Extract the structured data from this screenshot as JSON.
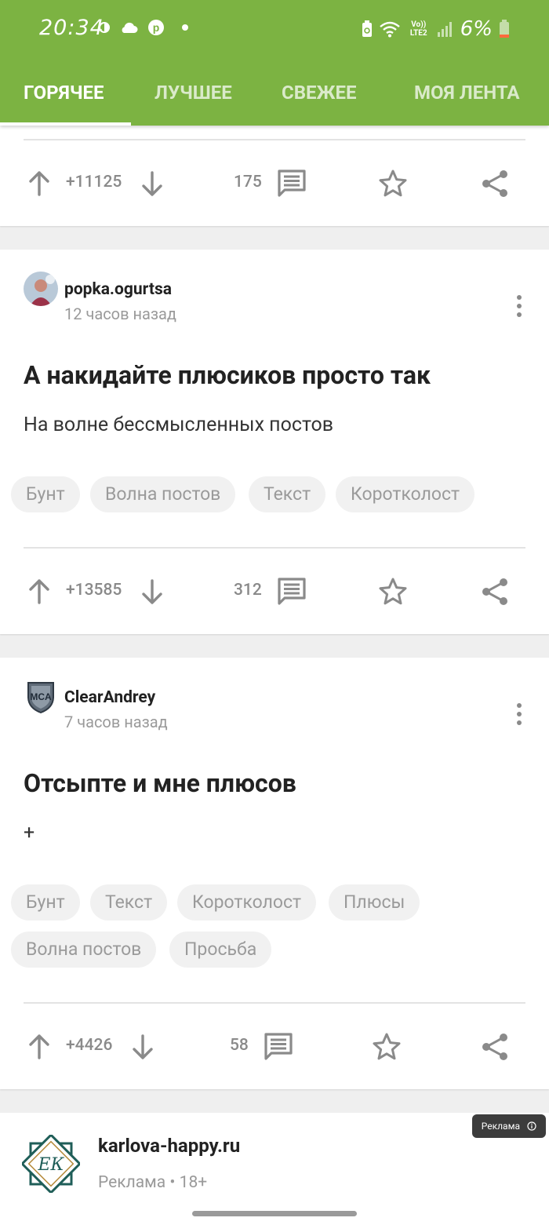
{
  "status_bar": {
    "time": "20:34",
    "lte_label": "Vo)) LTE2",
    "battery_percent": "6%"
  },
  "tabs": [
    {
      "label": "ГОРЯЧЕЕ",
      "active": true
    },
    {
      "label": "ЛУЧШЕЕ",
      "active": false
    },
    {
      "label": "СВЕЖЕЕ",
      "active": false
    },
    {
      "label": "МОЯ ЛЕНТА",
      "active": false
    }
  ],
  "posts": [
    {
      "rating": "+11125",
      "comments": "175"
    },
    {
      "author": "popka.ogurtsa",
      "time_ago": "12 часов назад",
      "title": "А накидайте плюсиков просто так",
      "text": "На волне бессмысленных постов",
      "tags": [
        "Бунт",
        "Волна постов",
        "Текст",
        "Коротколост"
      ],
      "rating": "+13585",
      "comments": "312"
    },
    {
      "author": "ClearAndrey",
      "time_ago": "7 часов назад",
      "title": "Отсыпте и мне плюсов",
      "text": "+",
      "tags": [
        "Бунт",
        "Текст",
        "Коротколост",
        "Плюсы",
        "Волна постов",
        "Просьба"
      ],
      "rating": "+4426",
      "comments": "58"
    }
  ],
  "ad": {
    "site": "karlova-happy.ru",
    "meta": "Реклама • 18+",
    "badge": "Реклама"
  },
  "colors": {
    "brand_green": "#7cb342",
    "icon_gray": "#8a8a8a"
  }
}
